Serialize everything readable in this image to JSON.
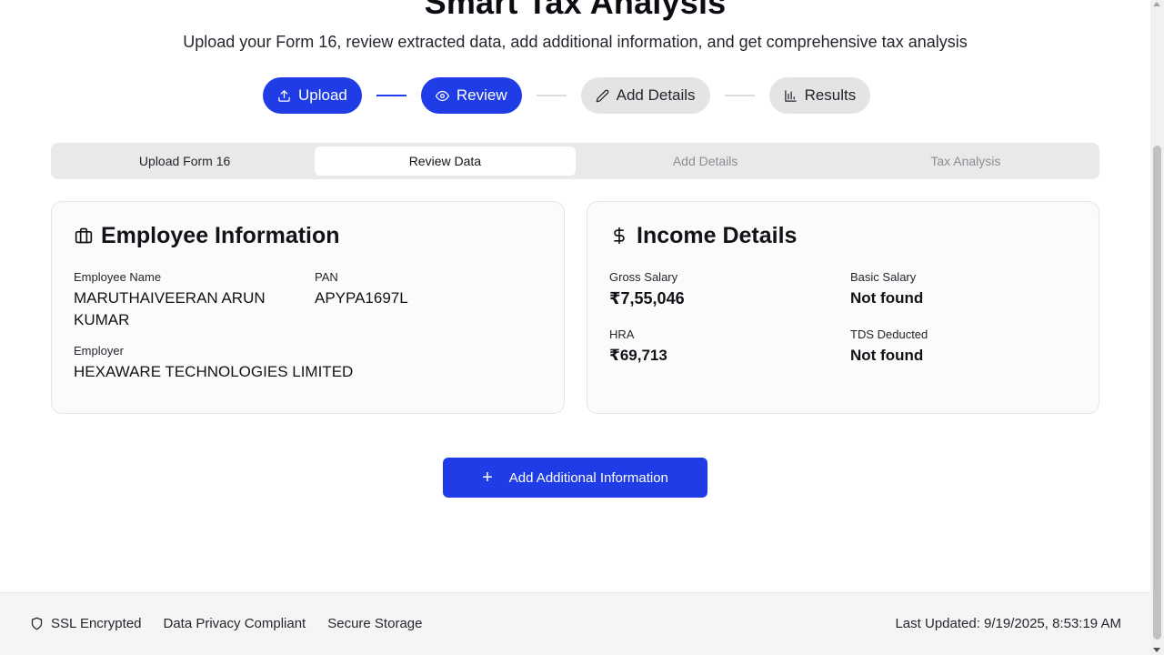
{
  "header": {
    "title": "Smart Tax Analysis",
    "subtitle": "Upload your Form 16, review extracted data, add additional information, and get comprehensive tax analysis"
  },
  "stepper": {
    "steps": [
      {
        "label": "Upload",
        "icon": "upload-icon",
        "state": "active"
      },
      {
        "label": "Review",
        "icon": "eye-icon",
        "state": "active"
      },
      {
        "label": "Add Details",
        "icon": "pencil-icon",
        "state": "inactive"
      },
      {
        "label": "Results",
        "icon": "bar-chart-icon",
        "state": "inactive"
      }
    ]
  },
  "tabs": [
    {
      "label": "Upload Form 16",
      "state": "enabled"
    },
    {
      "label": "Review Data",
      "state": "selected"
    },
    {
      "label": "Add Details",
      "state": "disabled"
    },
    {
      "label": "Tax Analysis",
      "state": "disabled"
    }
  ],
  "employee_card": {
    "title": "Employee Information",
    "icon": "briefcase-icon",
    "name_label": "Employee Name",
    "name_value": "MARUTHAIVEERAN ARUN KUMAR",
    "pan_label": "PAN",
    "pan_value": "APYPA1697L",
    "employer_label": "Employer",
    "employer_value": "HEXAWARE TECHNOLOGIES LIMITED"
  },
  "income_card": {
    "title": "Income Details",
    "icon": "dollar-icon",
    "gross_label": "Gross Salary",
    "gross_value": "₹7,55,046",
    "basic_label": "Basic Salary",
    "basic_value": "Not found",
    "hra_label": "HRA",
    "hra_value": "₹69,713",
    "tds_label": "TDS Deducted",
    "tds_value": "Not found"
  },
  "actions": {
    "add_info_label": "Add Additional Information"
  },
  "footer": {
    "ssl": "SSL Encrypted",
    "privacy": "Data Privacy Compliant",
    "storage": "Secure Storage",
    "last_updated": "Last Updated: 9/19/2025, 8:53:19 AM"
  },
  "colors": {
    "accent": "#1f3ce6",
    "inactive_pill": "#e4e4e4"
  }
}
